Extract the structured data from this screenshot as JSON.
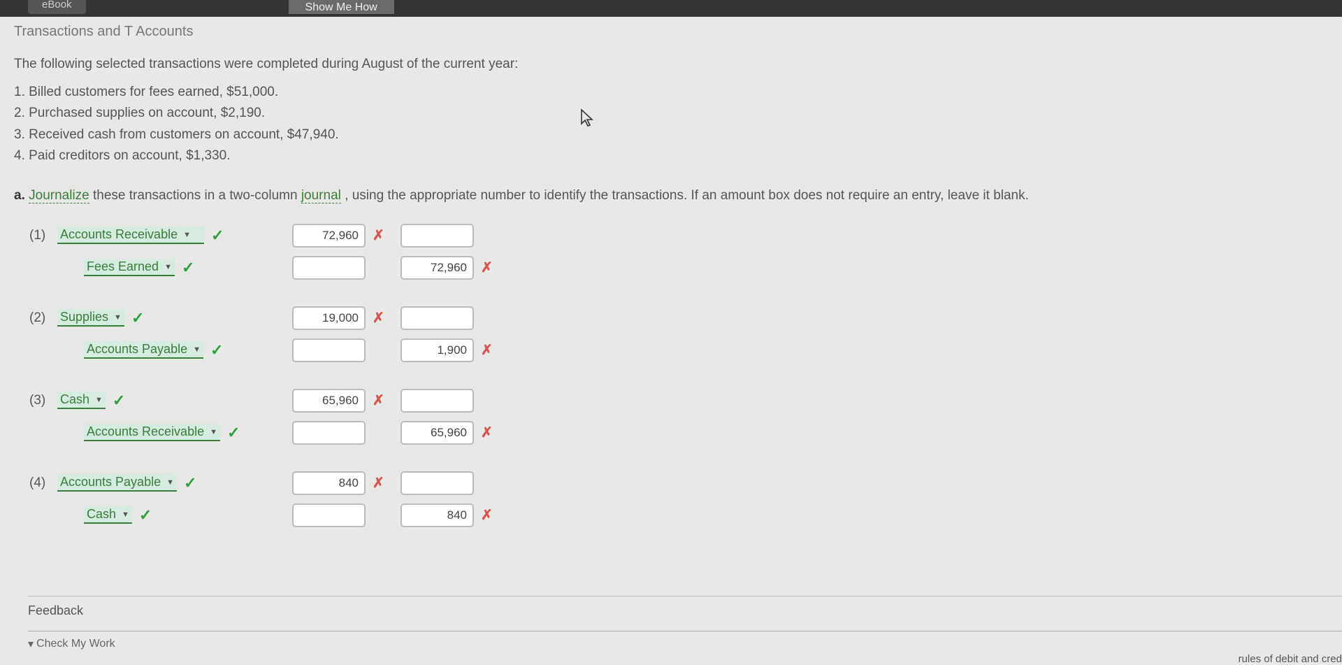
{
  "topbar": {
    "ebook": "eBook",
    "show_me_how": "Show Me How"
  },
  "title": "Transactions and T Accounts",
  "intro": "The following selected transactions were completed during August of the current year:",
  "transactions": [
    "1. Billed customers for fees earned, $51,000.",
    "2. Purchased supplies on account, $2,190.",
    "3. Received cash from customers on account, $47,940.",
    "4. Paid creditors on account, $1,330."
  ],
  "instruction": {
    "prefix": "a. ",
    "w1": "Journalize",
    "mid1": " these transactions in a two-column ",
    "w2": "journal",
    "rest": ", using the appropriate number to identify the transactions. If an amount box does not require an entry, leave it blank."
  },
  "marks": {
    "check": "✓",
    "x": "✗",
    "tri": "▼",
    "down": "▾"
  },
  "entries": [
    {
      "num": "(1)",
      "debit": {
        "account": "Accounts Receivable",
        "amount": "72,960"
      },
      "credit": {
        "account": "Fees Earned",
        "amount": "72,960"
      }
    },
    {
      "num": "(2)",
      "debit": {
        "account": "Supplies",
        "amount": "19,000"
      },
      "credit": {
        "account": "Accounts Payable",
        "amount": "1,900"
      }
    },
    {
      "num": "(3)",
      "debit": {
        "account": "Cash",
        "amount": "65,960"
      },
      "credit": {
        "account": "Accounts Receivable",
        "amount": "65,960"
      }
    },
    {
      "num": "(4)",
      "debit": {
        "account": "Accounts Payable",
        "amount": "840"
      },
      "credit": {
        "account": "Cash",
        "amount": "840"
      }
    }
  ],
  "feedback": {
    "title": "Feedback",
    "check_work": "Check My Work"
  },
  "bottom_fragment": "rules of debit and cred"
}
